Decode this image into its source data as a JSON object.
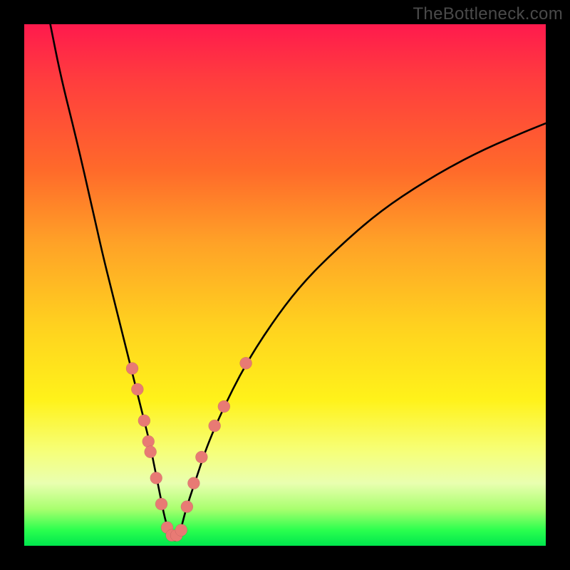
{
  "watermark": "TheBottleneck.com",
  "chart_data": {
    "type": "line",
    "title": "",
    "xlabel": "",
    "ylabel": "",
    "xlim": [
      0,
      100
    ],
    "ylim": [
      0,
      100
    ],
    "grid": false,
    "legend": false,
    "description": "V-shaped bottleneck curve over a red-to-green vertical gradient. Two black curves descend from the top edges and meet near the bottom at roughly x≈27. Light-red dots mark several points along the lower portions of both branches.",
    "series": [
      {
        "name": "left-branch",
        "x": [
          5,
          7,
          10,
          13,
          15,
          17,
          19,
          20,
          21,
          22,
          23,
          24,
          25,
          26,
          27,
          28,
          29
        ],
        "y": [
          100,
          90,
          78,
          65,
          56,
          48,
          40,
          36,
          32,
          28,
          24,
          20,
          15,
          10,
          5,
          2,
          1
        ]
      },
      {
        "name": "right-branch",
        "x": [
          29,
          30,
          31,
          33,
          35,
          38,
          42,
          47,
          53,
          60,
          68,
          77,
          86,
          95,
          100
        ],
        "y": [
          1,
          3,
          7,
          13,
          19,
          26,
          34,
          42,
          50,
          57,
          64,
          70,
          75,
          79,
          81
        ]
      }
    ],
    "dots": [
      {
        "branch": "left",
        "x": 20.7,
        "y": 34
      },
      {
        "branch": "left",
        "x": 21.7,
        "y": 30
      },
      {
        "branch": "left",
        "x": 23.0,
        "y": 24
      },
      {
        "branch": "left",
        "x": 23.8,
        "y": 20
      },
      {
        "branch": "left",
        "x": 24.2,
        "y": 18
      },
      {
        "branch": "left",
        "x": 25.3,
        "y": 13
      },
      {
        "branch": "left",
        "x": 26.3,
        "y": 8
      },
      {
        "branch": "left",
        "x": 27.4,
        "y": 3.5
      },
      {
        "branch": "left",
        "x": 28.3,
        "y": 2
      },
      {
        "branch": "right",
        "x": 29.2,
        "y": 2
      },
      {
        "branch": "right",
        "x": 30.1,
        "y": 3
      },
      {
        "branch": "right",
        "x": 31.2,
        "y": 7.5
      },
      {
        "branch": "right",
        "x": 32.5,
        "y": 12
      },
      {
        "branch": "right",
        "x": 34.0,
        "y": 17
      },
      {
        "branch": "right",
        "x": 36.5,
        "y": 23
      },
      {
        "branch": "right",
        "x": 38.3,
        "y": 26.7
      },
      {
        "branch": "right",
        "x": 42.5,
        "y": 35
      }
    ]
  },
  "colors": {
    "curve": "#000000",
    "dot_fill": "#e87a74",
    "gradient_top": "#ff1a4d",
    "gradient_bottom": "#00e64d"
  }
}
